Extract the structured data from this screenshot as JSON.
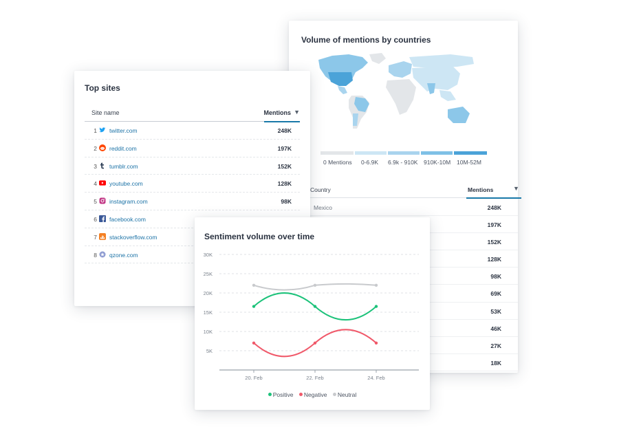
{
  "top_sites": {
    "title": "Top sites",
    "col_site": "Site name",
    "col_mentions": "Mentions",
    "sort_glyph": "▼",
    "rows": [
      {
        "rank": "1",
        "name": "twitter.com",
        "value": "248K",
        "icon": "twitter-icon"
      },
      {
        "rank": "2",
        "name": "reddit.com",
        "value": "197K",
        "icon": "reddit-icon"
      },
      {
        "rank": "3",
        "name": "tumblr.com",
        "value": "152K",
        "icon": "tumblr-icon"
      },
      {
        "rank": "4",
        "name": "youtube.com",
        "value": "128K",
        "icon": "youtube-icon"
      },
      {
        "rank": "5",
        "name": "instagram.com",
        "value": "98K",
        "icon": "instagram-icon"
      },
      {
        "rank": "6",
        "name": "facebook.com",
        "value": "",
        "icon": "facebook-icon"
      },
      {
        "rank": "7",
        "name": "stackoverflow.com",
        "value": "",
        "icon": "stackoverflow-icon"
      },
      {
        "rank": "8",
        "name": "qzone.com",
        "value": "",
        "icon": "qzone-icon"
      }
    ]
  },
  "countries": {
    "title": "Volume of mentions by countries",
    "legend": [
      {
        "label": "0 Mentions",
        "color": "#e3e6e9"
      },
      {
        "label": "0-6.9K",
        "color": "#cde6f4"
      },
      {
        "label": "6.9k - 910K",
        "color": "#a9d4ee"
      },
      {
        "label": "910K-10M",
        "color": "#7fc0e6"
      },
      {
        "label": "10M-52M",
        "color": "#4ba3d8"
      }
    ],
    "col_country": "Country",
    "col_mentions": "Mentions",
    "sort_glyph": "▼",
    "rows": [
      {
        "name": "Mexico",
        "value": "248K"
      },
      {
        "name": "",
        "value": "197K"
      },
      {
        "name": "",
        "value": "152K"
      },
      {
        "name": "",
        "value": "128K"
      },
      {
        "name": "",
        "value": "98K"
      },
      {
        "name": "",
        "value": "69K"
      },
      {
        "name": "",
        "value": "53K"
      },
      {
        "name": "",
        "value": "46K"
      },
      {
        "name": "",
        "value": "27K"
      },
      {
        "name": "",
        "value": "18K"
      }
    ]
  },
  "sentiment": {
    "title": "Sentiment volume over time",
    "legend": [
      {
        "label": "Positive",
        "color": "#1cc27a"
      },
      {
        "label": "Negative",
        "color": "#f0596a"
      },
      {
        "label": "Neutral",
        "color": "#c8cacd"
      }
    ]
  },
  "chart_data": {
    "type": "line",
    "title": "Sentiment volume over time",
    "x": [
      "20 Feb",
      "22 Feb",
      "24 Feb"
    ],
    "xticks": [
      "20. Feb",
      "22. Feb",
      "24. Feb"
    ],
    "x_days": [
      20,
      22,
      24
    ],
    "yticks": [
      "5K",
      "10K",
      "15K",
      "20K",
      "25K",
      "30K"
    ],
    "ylim": [
      0,
      30000
    ],
    "grid": true,
    "legend_position": "bottom",
    "series": [
      {
        "name": "Positive",
        "color": "#1cc27a",
        "points": [
          [
            20,
            16500
          ],
          [
            22,
            16500
          ],
          [
            24,
            16500
          ]
        ]
      },
      {
        "name": "Negative",
        "color": "#f0596a",
        "points": [
          [
            20,
            7000
          ],
          [
            22,
            7000
          ],
          [
            24,
            7000
          ]
        ]
      },
      {
        "name": "Neutral",
        "color": "#c8cacd",
        "points": [
          [
            20,
            22000
          ],
          [
            22,
            22000
          ],
          [
            24,
            22000
          ]
        ]
      }
    ]
  }
}
